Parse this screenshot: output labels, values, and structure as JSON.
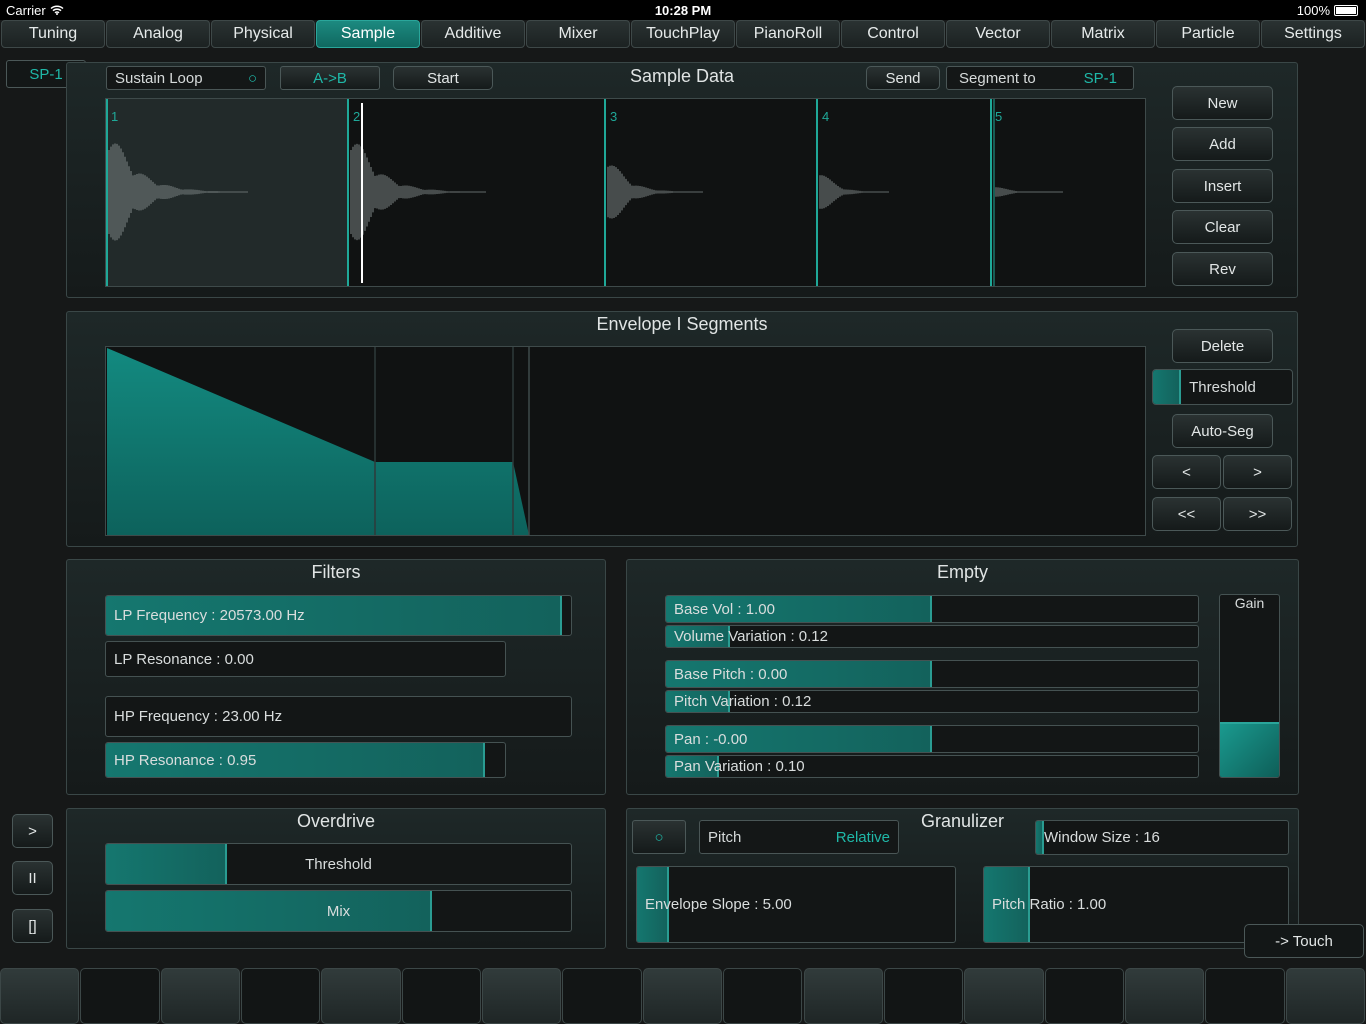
{
  "status": {
    "carrier": "Carrier",
    "time": "10:28 PM",
    "battery": "100%"
  },
  "tabs": [
    {
      "label": "Tuning",
      "active": false
    },
    {
      "label": "Analog",
      "active": false
    },
    {
      "label": "Physical",
      "active": false
    },
    {
      "label": "Sample",
      "active": true
    },
    {
      "label": "Additive",
      "active": false
    },
    {
      "label": "Mixer",
      "active": false
    },
    {
      "label": "TouchPlay",
      "active": false
    },
    {
      "label": "PianoRoll",
      "active": false
    },
    {
      "label": "Control",
      "active": false
    },
    {
      "label": "Vector",
      "active": false
    },
    {
      "label": "Matrix",
      "active": false
    },
    {
      "label": "Particle",
      "active": false
    },
    {
      "label": "Settings",
      "active": false
    }
  ],
  "preset": "SP-1",
  "sample": {
    "title": "Sample Data",
    "sustain_loop": "Sustain Loop",
    "ab": "A->B",
    "start": "Start",
    "send": "Send",
    "segment_to": "Segment to",
    "segment_target": "SP-1",
    "segment_numbers": [
      "1",
      "2",
      "3",
      "4",
      "5"
    ],
    "buttons": [
      "New",
      "Add",
      "Insert",
      "Clear",
      "Rev"
    ]
  },
  "envelope": {
    "title": "Envelope I Segments",
    "delete": "Delete",
    "threshold": "Threshold",
    "threshold_level": 0.2,
    "autoseg": "Auto-Seg",
    "prev": "<",
    "next": ">",
    "first": "<<",
    "last": ">>"
  },
  "filters": {
    "title": "Filters",
    "lp_freq": {
      "label": "LP Frequency : 20573.00 Hz",
      "level": 0.98
    },
    "lp_res": {
      "label": "LP Resonance : 0.00",
      "level": 0.0
    },
    "hp_freq": {
      "label": "HP Frequency : 23.00 Hz",
      "level": 0.0
    },
    "hp_res": {
      "label": "HP Resonance : 0.95",
      "level": 0.95
    }
  },
  "empty": {
    "title": "Empty",
    "base_vol": {
      "label": "Base Vol : 1.00",
      "level": 0.5
    },
    "vol_var": {
      "label": "Volume Variation : 0.12",
      "level": 0.12
    },
    "base_pitch": {
      "label": "Base Pitch : 0.00",
      "level": 0.5
    },
    "pitch_var": {
      "label": "Pitch Variation : 0.12",
      "level": 0.12
    },
    "pan": {
      "label": "Pan : -0.00",
      "level": 0.5
    },
    "pan_var": {
      "label": "Pan Variation : 0.10",
      "level": 0.1
    },
    "gain": {
      "label": "Gain",
      "level": 0.3
    }
  },
  "overdrive": {
    "title": "Overdrive",
    "threshold": {
      "label": "Threshold",
      "level": 0.26
    },
    "mix": {
      "label": "Mix",
      "level": 0.7
    }
  },
  "granulizer": {
    "title": "Granulizer",
    "toggle": "○",
    "pitch": "Pitch",
    "pitch_mode": "Relative",
    "window": {
      "label": "Window Size : 16",
      "level": 0.03
    },
    "env_slope": {
      "label": "Envelope Slope : 5.00",
      "level": 0.1
    },
    "pitch_ratio": {
      "label": "Pitch Ratio : 1.00",
      "level": 0.15
    }
  },
  "transport": {
    "play": ">",
    "pause": "II",
    "stop": "[]"
  },
  "touch": "-> Touch"
}
